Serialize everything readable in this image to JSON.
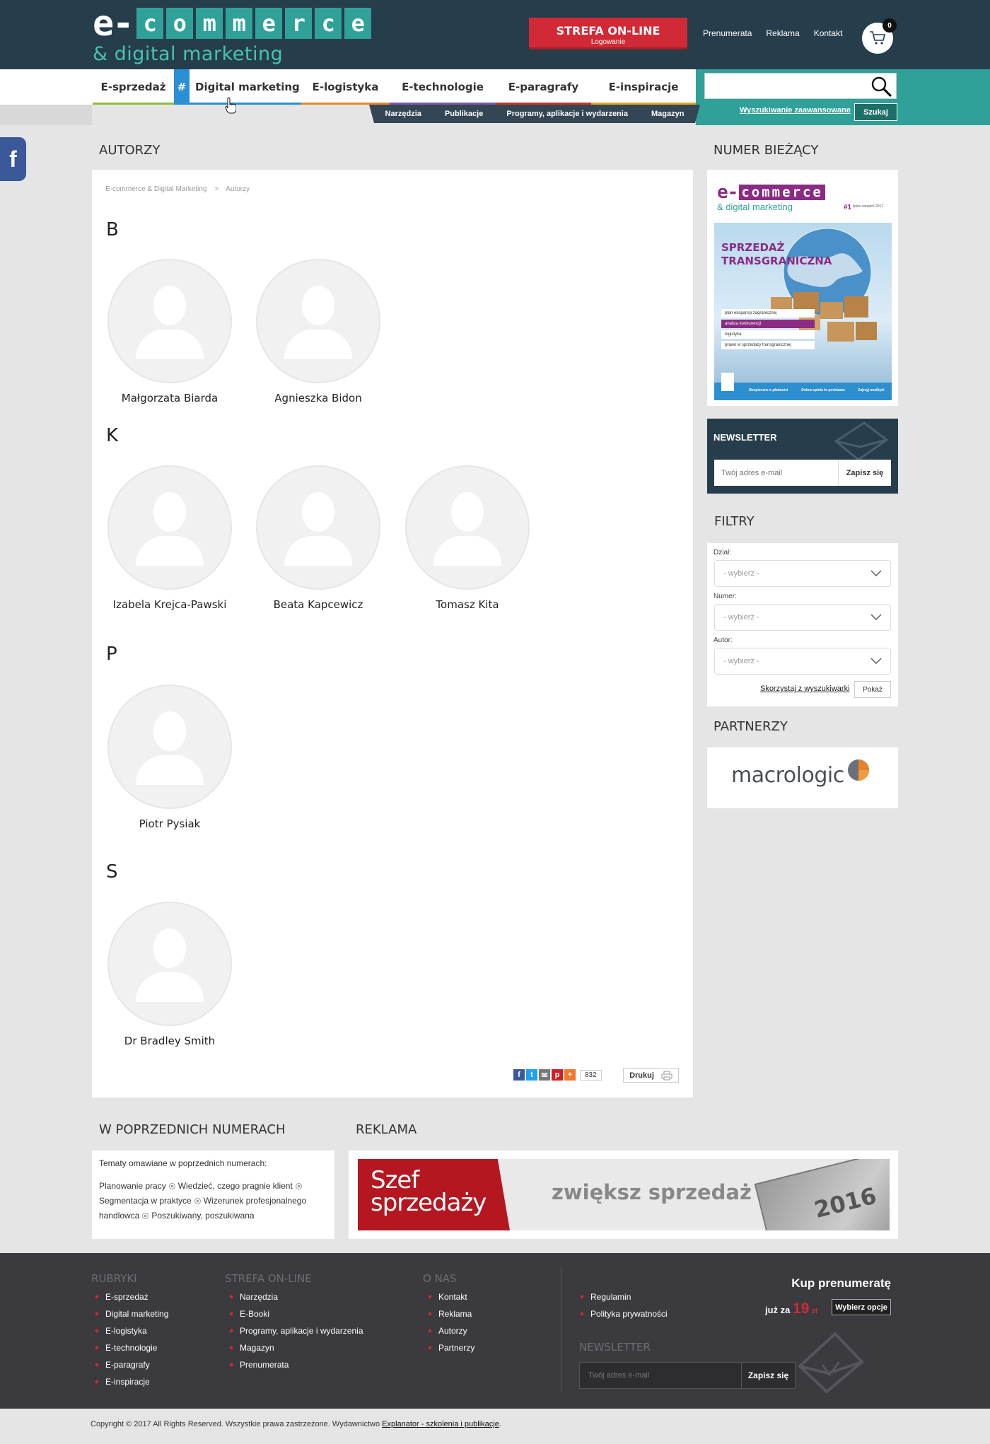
{
  "header": {
    "logo_e": "e-",
    "logo_letters": [
      "c",
      "o",
      "m",
      "m",
      "e",
      "r",
      "c",
      "e"
    ],
    "logo_sub": "& digital marketing",
    "strefa_title": "STREFA ON-LINE",
    "strefa_sub": "Logowanie",
    "links": [
      "Prenumerata",
      "Reklama",
      "Kontakt"
    ],
    "cart_count": "0"
  },
  "nav": {
    "items": [
      {
        "label": "E-sprzedaż",
        "color": "#8cbf3f"
      },
      {
        "label": "Digital marketing",
        "color": "#2b8fd4",
        "hash": "#"
      },
      {
        "label": "E-logistyka",
        "color": "#e08a2c"
      },
      {
        "label": "E-technologie",
        "color": "#7a5aa6"
      },
      {
        "label": "E-paragrafy",
        "color": "#c0392b"
      },
      {
        "label": "E-inspiracje",
        "color": "#e0a82c"
      }
    ],
    "sub": [
      "Narzędzia",
      "Publikacje",
      "Programy, aplikacje i wydarzenia",
      "Magazyn"
    ],
    "advanced_search": "Wyszukiwanie zaawansowane",
    "search_button": "Szukaj"
  },
  "facebook": "f",
  "main": {
    "title": "AUTORZY",
    "breadcrumb": [
      "E-commerce & Digital Marketing",
      "Autorzy"
    ],
    "breadcrumb_sep": ">",
    "groups": [
      {
        "letter": "B",
        "authors": [
          "Małgorzata Biarda",
          "Agnieszka Bidon"
        ]
      },
      {
        "letter": "K",
        "authors": [
          "Izabela Krejca-Pawski",
          "Beata Kapcewicz",
          "Tomasz Kita"
        ]
      },
      {
        "letter": "P",
        "authors": [
          "Piotr Pysiak"
        ]
      },
      {
        "letter": "S",
        "authors": [
          "Dr Bradley Smith"
        ]
      }
    ],
    "share_count": "832",
    "print_label": "Drukuj"
  },
  "sidebar": {
    "current_issue_title": "NUMER BIEŻĄCY",
    "cover": {
      "logo_e": "e-",
      "logo_word": "commerce",
      "logo_sub": "& digital marketing",
      "issue_no": "#1",
      "issue_meta": "lipiec-sierpień 2017",
      "headline": [
        "SPRZEDAŻ",
        "TRANSGRANICZNA"
      ],
      "bullets": [
        "plan ekspansji zagranicznej",
        "analiza konkurencji",
        "logistyka",
        "prawo w sprzedaży transgranicznej"
      ],
      "bottom": [
        "Bezpieczne e-płatności",
        "Dobra opinia to podstawa",
        "Zajrzyj analityki"
      ]
    },
    "newsletter": {
      "title": "NEWSLETTER",
      "placeholder": "Twój adres e-mail",
      "button": "Zapisz się"
    },
    "filters": {
      "title": "FILTRY",
      "fields": [
        {
          "label": "Dział:",
          "value": "- wybierz -"
        },
        {
          "label": "Numer:",
          "value": "- wybierz -"
        },
        {
          "label": "Autor:",
          "value": "- wybierz -"
        }
      ],
      "link": "Skorzystaj z wyszukiwarki",
      "button": "Pokaż"
    },
    "partners_title": "PARTNERZY",
    "partner_name": "macrologic"
  },
  "previous": {
    "title": "W POPRZEDNICH NUMERACH",
    "intro": "Tematy omawiane w poprzednich numerach:",
    "tags": [
      "Planowanie pracy",
      "Wiedzieć, czego pragnie klient",
      "Segmentacja w praktyce",
      "Wizerunek profesjonalnego handlowca",
      "Poszukiwany, poszukiwana"
    ]
  },
  "ad": {
    "title": "REKLAMA",
    "brand": [
      "Szef",
      "sprzedaży"
    ],
    "slogan": "zwiększ sprzedaż",
    "year": "2016"
  },
  "footer": {
    "columns": [
      {
        "title": "RUBRYKI",
        "items": [
          "E-sprzedaż",
          "Digital marketing",
          "E-logistyka",
          "E-technologie",
          "E-paragrafy",
          "E-inspiracje"
        ]
      },
      {
        "title": "STREFA ON-LINE",
        "items": [
          "Narzędzia",
          "E-Booki",
          "Programy, aplikacje i wydarzenia",
          "Magazyn",
          "Prenumerata"
        ]
      },
      {
        "title": "O NAS",
        "items": [
          "Kontakt",
          "Reklama",
          "Autorzy",
          "Partnerzy"
        ]
      }
    ],
    "legal": [
      "Regulamin",
      "Polityka prywatności"
    ],
    "kup_title": "Kup prenumeratę",
    "kup_prefix": "już za",
    "kup_price": "19",
    "kup_unit": "zł",
    "kup_button": "Wybierz opcje",
    "newsletter_title": "NEWSLETTER",
    "newsletter_placeholder": "Twój adres e-mail",
    "newsletter_button": "Zapisz się",
    "copyright": "Copyright © 2017 All Rights Reserved. Wszystkie prawa zastrzeżone. Wydawnictwo",
    "publisher": "Explanator - szkolenia i publikacje"
  }
}
